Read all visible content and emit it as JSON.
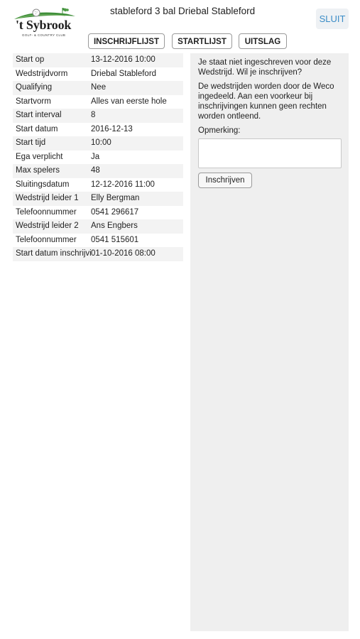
{
  "logo": {
    "name": "'t Sybrook",
    "subtitle": "GOLF- & COUNTRY CLUB"
  },
  "header": {
    "title": "stableford 3 bal Driebal Stableford",
    "close_label": "SLUIT"
  },
  "tabs": [
    {
      "label": "INSCHRIJFLIJST"
    },
    {
      "label": "STARTLIJST"
    },
    {
      "label": "UITSLAG"
    }
  ],
  "details": [
    {
      "label": "Start op",
      "value": "13-12-2016 10:00"
    },
    {
      "label": "Wedstrijdvorm",
      "value": "Driebal Stableford"
    },
    {
      "label": "Qualifying",
      "value": "Nee"
    },
    {
      "label": "Startvorm",
      "value": "Alles van eerste hole"
    },
    {
      "label": "Start interval",
      "value": "8"
    },
    {
      "label": "Start datum",
      "value": "2016-12-13"
    },
    {
      "label": "Start tijd",
      "value": "10:00"
    },
    {
      "label": "Ega verplicht",
      "value": "Ja"
    },
    {
      "label": "Max spelers",
      "value": "48"
    },
    {
      "label": "Sluitingsdatum",
      "value": "12-12-2016 11:00"
    },
    {
      "label": "Wedstrijd leider 1",
      "value": "Elly Bergman"
    },
    {
      "label": "Telefoonnummer",
      "value": "0541 296617"
    },
    {
      "label": "Wedstrijd leider 2",
      "value": "Ans Engbers"
    },
    {
      "label": "Telefoonnummer",
      "value": "0541 515601"
    },
    {
      "label": "Start datum inschrijving",
      "value": "01-10-2016 08:00"
    }
  ],
  "registration": {
    "not_registered_message": "Je staat niet ingeschreven voor deze Wedstrijd. Wil je inschrijven?",
    "info_message": "De wedstrijden worden door de Weco ingedeeld. Aan een voorkeur bij inschrijvingen kunnen geen rechten worden ontleend.",
    "remark_label": "Opmerking:",
    "remark_value": "",
    "submit_label": "Inschrijven"
  },
  "colors": {
    "accent": "#3a8cc7",
    "logo_green": "#3f8f3a",
    "panel_bg": "#efefef"
  }
}
